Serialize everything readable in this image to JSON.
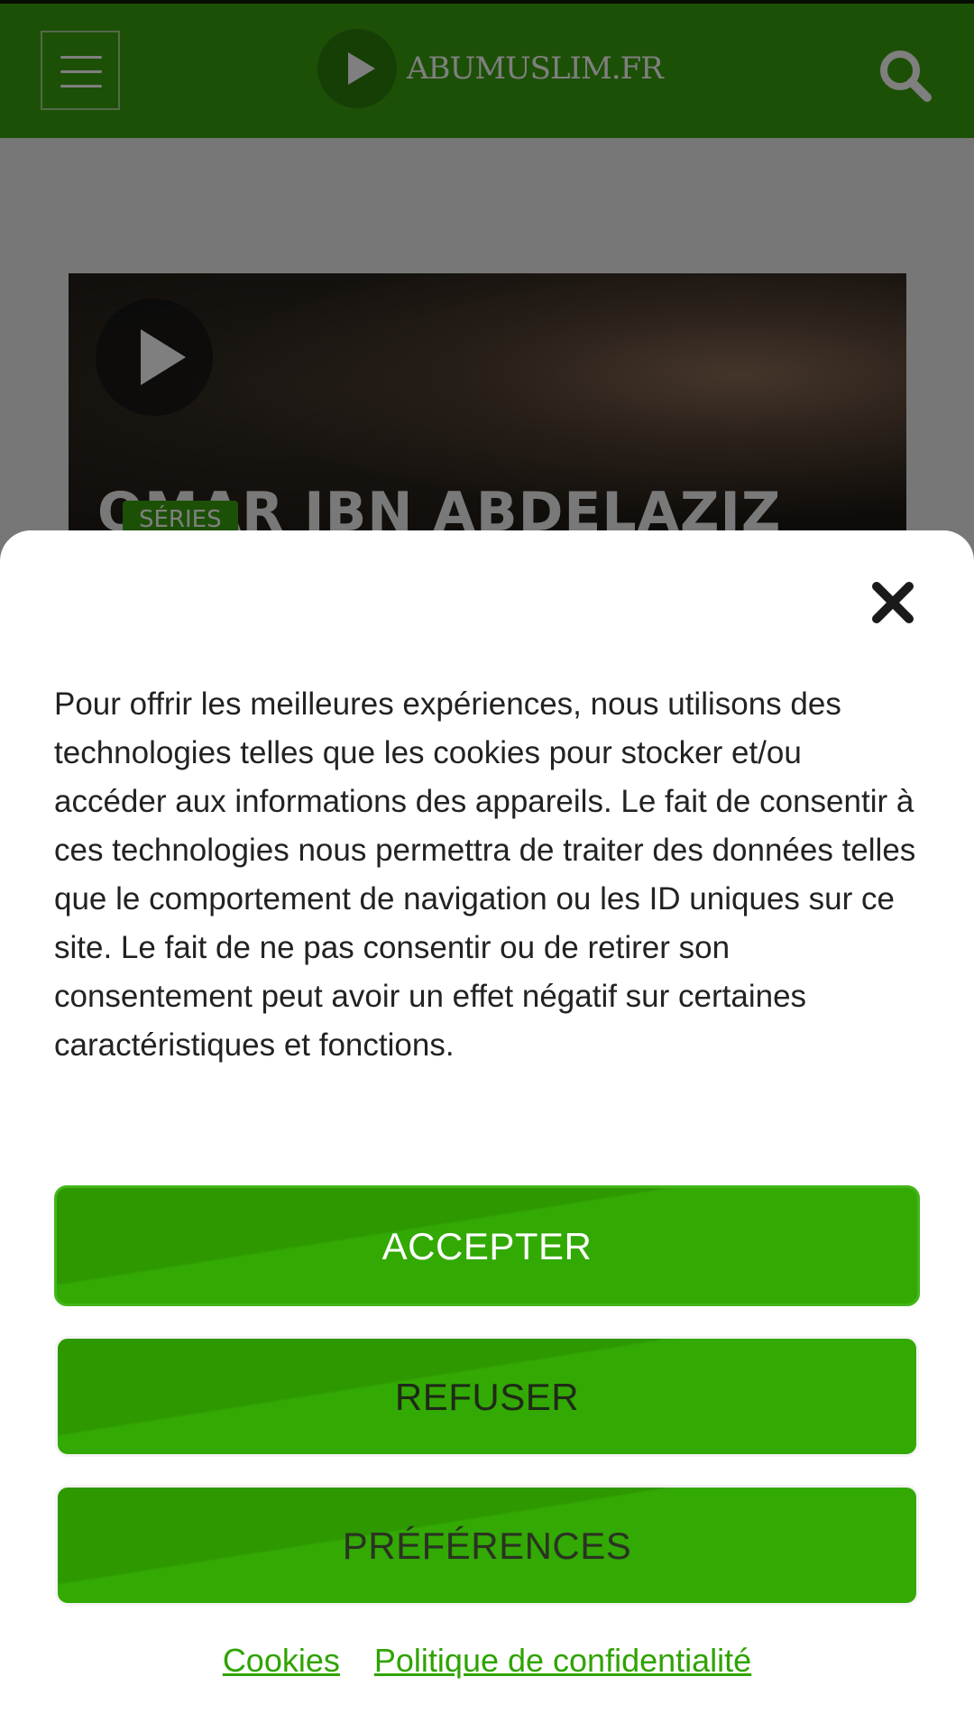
{
  "header": {
    "logo_text": "ABUMUSLIM.FR",
    "brand_color": "#3aa00e",
    "menu_icon": "hamburger-icon",
    "search_icon": "search-icon"
  },
  "hero": {
    "title": "OMAR IBN ABDELAZIZ",
    "badge": "SÉRIES",
    "play_icon": "play-icon"
  },
  "cookie_banner": {
    "close_icon": "close-icon",
    "text": "Pour offrir les meilleures expériences, nous utilisons des technologies telles que les cookies pour stocker et/ou accéder aux informations des appareils. Le fait de consentir à ces technologies nous permettra de traiter des données telles que le comportement de navigation ou les ID uniques sur ce site. Le fait de ne pas consentir ou de retirer son consentement peut avoir un effet négatif sur certaines caractéristiques et fonctions.",
    "accept_label": "ACCEPTER",
    "refuse_label": "REFUSER",
    "preferences_label": "PRÉFÉRENCES",
    "links": {
      "cookies": "Cookies",
      "privacy": "Politique de confidentialité"
    },
    "button_color": "#33a904",
    "link_color": "#2fa300"
  }
}
